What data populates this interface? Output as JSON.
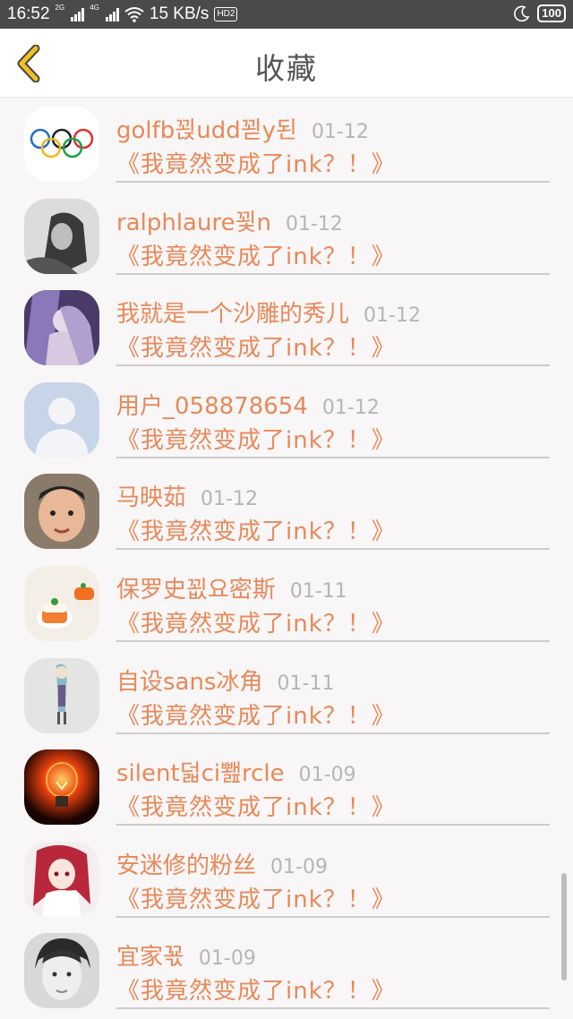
{
  "status_bar": {
    "time": "16:52",
    "sim1_network": "2G",
    "sim2_network": "4G",
    "speed": "15 KB/s",
    "hd_badge": "HD2",
    "battery": "100"
  },
  "header": {
    "title": "收藏",
    "back_icon": "chevron-left-icon"
  },
  "colors": {
    "accent": "#e8895a",
    "date": "#b8b4b4",
    "back_icon": "#f0c020"
  },
  "items": [
    {
      "name": "golfb꾅udd꾇y된",
      "date": "01-12",
      "title": "《我竟然变成了ink？！》",
      "avatar": "olympic-rings"
    },
    {
      "name": "ralphlaure꾗n",
      "date": "01-12",
      "title": "《我竟然变成了ink？！》",
      "avatar": "grayscale-girl"
    },
    {
      "name": "我就是一个沙雕的秀儿",
      "date": "01-12",
      "title": "《我竟然变成了ink？！》",
      "avatar": "anime-purple"
    },
    {
      "name": "用户_058878654",
      "date": "01-12",
      "title": "《我竟然变成了ink？！》",
      "avatar": "default-user"
    },
    {
      "name": "马映茹",
      "date": "01-12",
      "title": "《我竟然变成了ink？！》",
      "avatar": "child-photo"
    },
    {
      "name": "保罗史꾒요密斯",
      "date": "01-11",
      "title": "《我竟然变成了ink？！》",
      "avatar": "dessert"
    },
    {
      "name": "自设sans冰角",
      "date": "01-11",
      "title": "《我竟然变成了ink？！》",
      "avatar": "figure-sketch"
    },
    {
      "name": "silent덟ci뾆rcle",
      "date": "01-09",
      "title": "《我竟然变成了ink？！》",
      "avatar": "light-bulb"
    },
    {
      "name": "安迷修的粉丝",
      "date": "01-09",
      "title": "《我竟然变成了ink？！》",
      "avatar": "anime-redhead"
    },
    {
      "name": "宜家꾟",
      "date": "01-09",
      "title": "《我竟然变成了ink？！》",
      "avatar": "bw-portrait"
    }
  ]
}
